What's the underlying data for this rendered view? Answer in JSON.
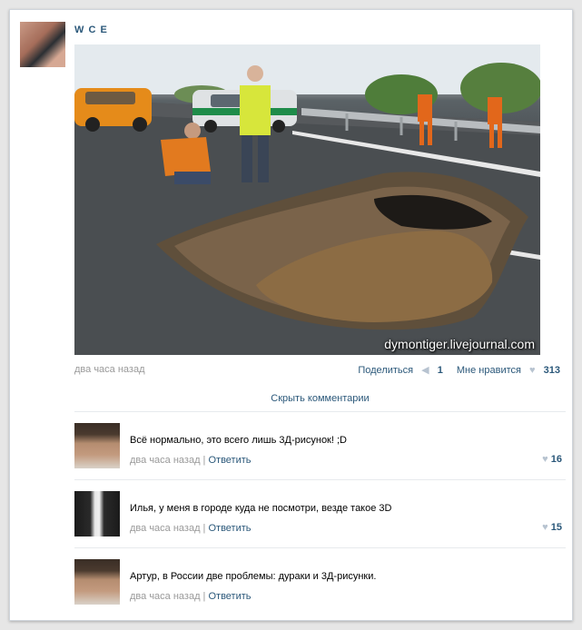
{
  "post": {
    "author": "W C E",
    "photo_caption": "dymontiger.livejournal.com",
    "time": "два часа назад",
    "share_label": "Поделиться",
    "share_count": "1",
    "like_label": "Мне нравится",
    "like_count": "313",
    "hide_comments": "Скрыть комментарии"
  },
  "comments": [
    {
      "text": "Всё нормально, это всего лишь 3Д-рисунок! ;D",
      "time": "два часа назад",
      "reply": "Ответить",
      "likes": "16"
    },
    {
      "text": "Илья, у меня в городе куда не посмотри, везде такое 3D",
      "time": "два часа назад",
      "reply": "Ответить",
      "likes": "15"
    },
    {
      "text": "Артур, в России две проблемы: дураки и 3Д-рисунки.",
      "time": "два часа назад",
      "reply": "Ответить",
      "likes": ""
    }
  ],
  "colors": {
    "link": "#2b587a",
    "muted": "#999999",
    "card_border": "#cfd5db"
  }
}
